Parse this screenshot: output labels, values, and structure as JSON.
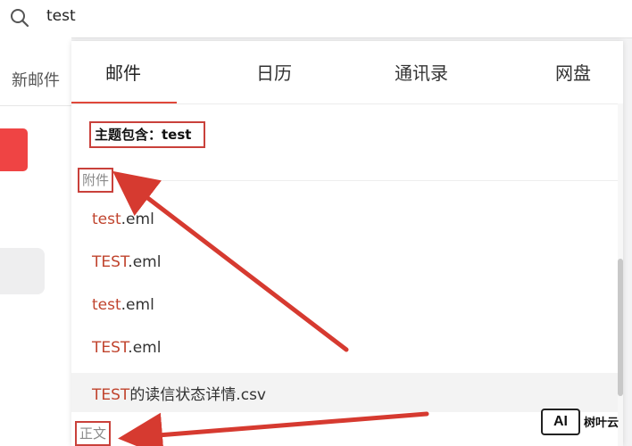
{
  "search": {
    "query": "test",
    "icon": "search-icon"
  },
  "sidebar": {
    "new_mail_label": "新邮件"
  },
  "tabs": [
    {
      "label": "邮件",
      "active": true
    },
    {
      "label": "日历",
      "active": false
    },
    {
      "label": "通讯录",
      "active": false
    },
    {
      "label": "网盘",
      "active": false
    }
  ],
  "subject_filter": {
    "label": "主题包含：test"
  },
  "sections": {
    "attachments_label": "附件",
    "body_label": "正文"
  },
  "attachments": [
    {
      "match": "test",
      "rest": ".eml",
      "highlighted": false
    },
    {
      "match": "TEST",
      "rest": ".eml",
      "highlighted": false
    },
    {
      "match": "test",
      "rest": ".eml",
      "highlighted": false
    },
    {
      "match": "TEST",
      "rest": ".eml",
      "highlighted": false
    },
    {
      "match": "TEST",
      "rest": "的读信状态详情.csv",
      "highlighted": true
    }
  ],
  "colors": {
    "accent": "#e0483a",
    "match_highlight": "#c0442e",
    "annotation": "#c9413b",
    "new_mail_button": "#ef4444"
  },
  "watermark": {
    "logo_text": "AI",
    "text": "树叶云"
  }
}
